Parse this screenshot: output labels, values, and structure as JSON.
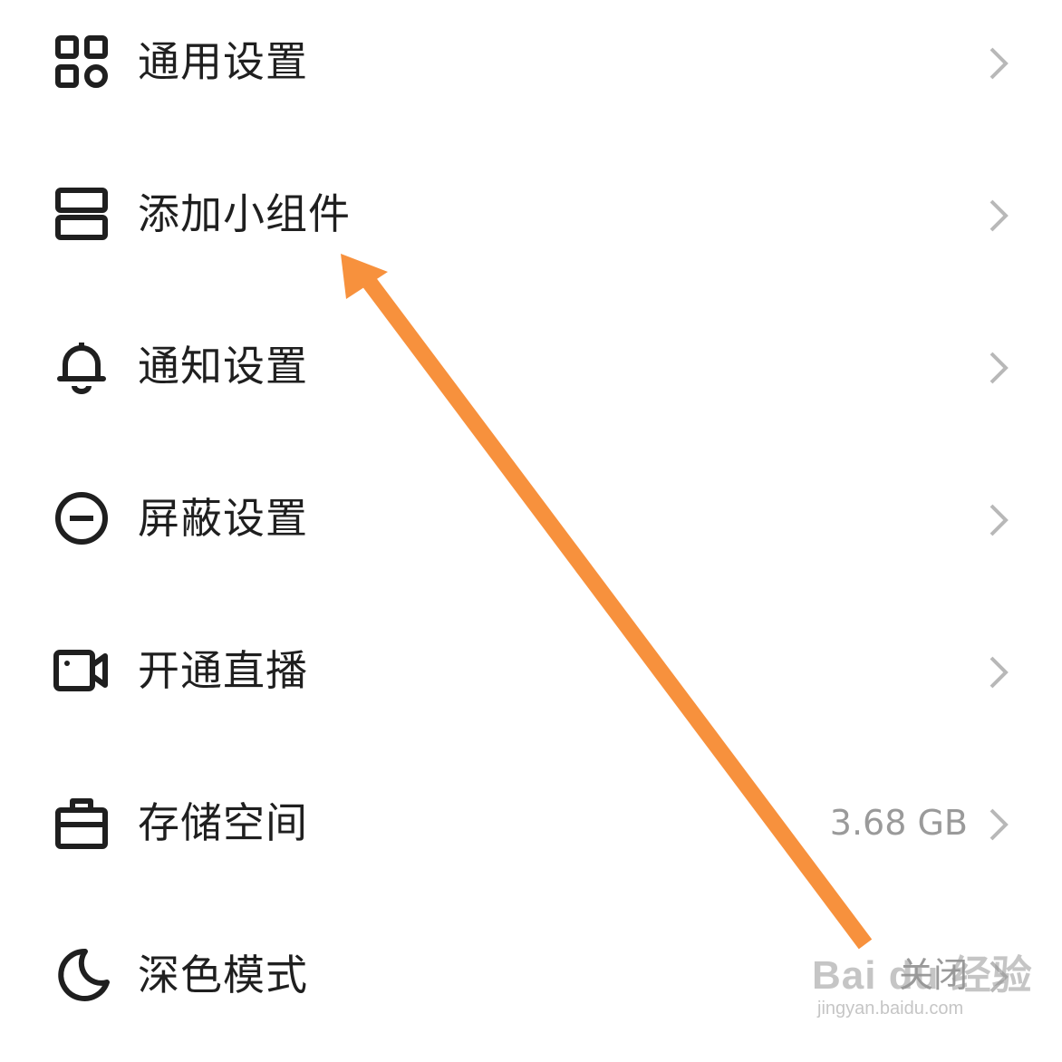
{
  "colors": {
    "text": "#1f1f1f",
    "secondary_text": "#9a9a9a",
    "chevron": "#b8b8b8",
    "annotation_arrow": "#f7913d"
  },
  "menu": {
    "items": [
      {
        "label": "通用设置",
        "icon": "grid-apps-icon"
      },
      {
        "label": "添加小组件",
        "icon": "widget-icon"
      },
      {
        "label": "通知设置",
        "icon": "bell-icon"
      },
      {
        "label": "屏蔽设置",
        "icon": "block-minus-icon"
      },
      {
        "label": "开通直播",
        "icon": "video-camera-icon"
      },
      {
        "label": "存储空间",
        "icon": "storage-box-icon",
        "value": "3.68 GB"
      },
      {
        "label": "深色模式",
        "icon": "moon-icon",
        "value": "关闭"
      }
    ]
  },
  "watermark": {
    "brand": "Bai du 经验",
    "url": "jingyan.baidu.com"
  }
}
